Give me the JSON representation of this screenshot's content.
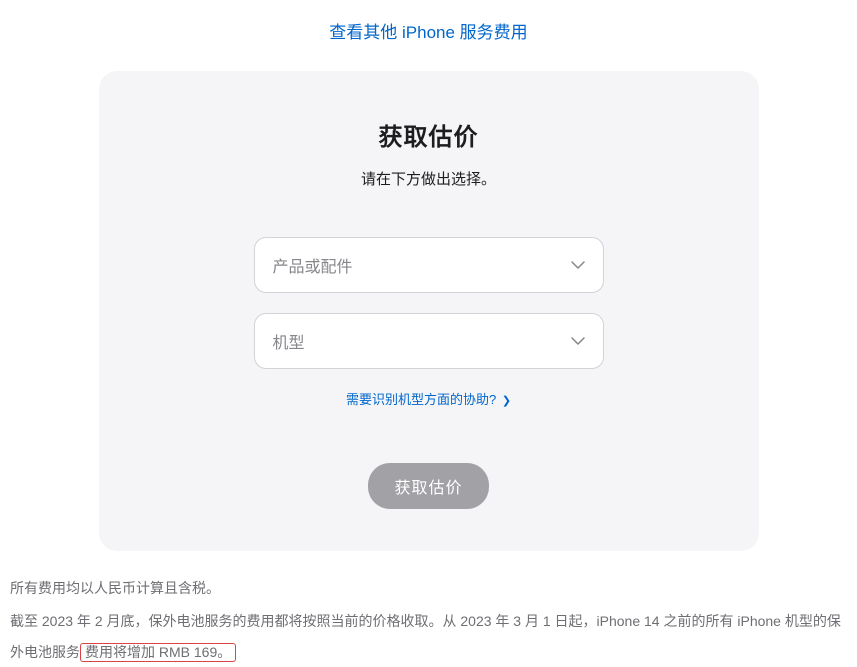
{
  "topLink": "查看其他 iPhone 服务费用",
  "card": {
    "title": "获取估价",
    "subtitle": "请在下方做出选择。",
    "productSelect": {
      "placeholder": "产品或配件"
    },
    "modelSelect": {
      "placeholder": "机型"
    },
    "helpLink": "需要识别机型方面的协助?",
    "button": "获取估价"
  },
  "footer": {
    "line1": "所有费用均以人民币计算且含税。",
    "line2_part1": "截至 2023 年 2 月底，保外电池服务的费用都将按照当前的价格收取。从 2023 年 3 月 1 日起，iPhone 14 之前的所有 iPhone 机型的保外电池服务",
    "line2_highlighted": "费用将增加 RMB 169。"
  }
}
